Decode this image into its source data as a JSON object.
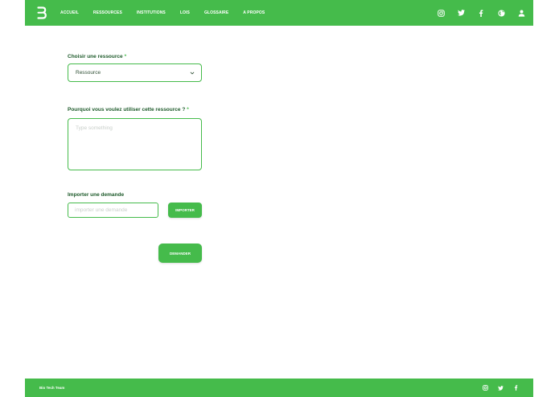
{
  "header": {
    "nav": [
      "ACCUEIL",
      "RESSOURCES",
      "INSTITUTIONS",
      "LOIS",
      "GLOSSAIRE",
      "A PROPOS"
    ],
    "icons": [
      "instagram-icon",
      "twitter-icon",
      "facebook-icon",
      "globe-icon",
      "user-icon"
    ]
  },
  "form": {
    "resource_label": "Choisir une ressource",
    "required_mark": "*",
    "resource_value": "Ressource",
    "reason_label": "Pourquoi vous voulez utiliser cette ressource ?",
    "reason_placeholder": "Type something",
    "import_label": "Importer une demande",
    "import_placeholder": "importer une demande",
    "import_button": "IMPORTER",
    "submit_button": "DEMANDER"
  },
  "footer": {
    "text": "Bio Tech Team",
    "icons": [
      "instagram-icon",
      "twitter-icon",
      "facebook-icon"
    ]
  },
  "colors": {
    "brand": "#45bb4b",
    "label": "#1d5a2a"
  }
}
